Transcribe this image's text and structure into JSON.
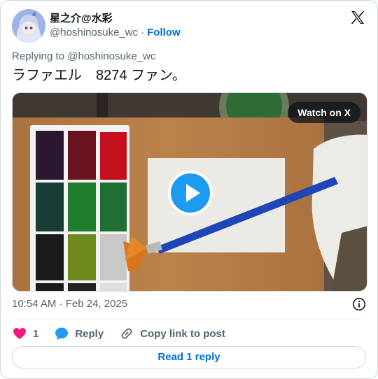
{
  "author": {
    "display_name": "星之介@水彩",
    "handle": "@hoshinosuke_wc",
    "separator": "·",
    "follow_label": "Follow"
  },
  "replying_to": "Replying to @hoshinosuke_wc",
  "tweet_text": "ラファエル　8274 ファン。",
  "media": {
    "watch_label": "Watch on X"
  },
  "timestamp": "10:54 AM · Feb 24, 2025",
  "actions": {
    "like_count": "1",
    "reply_label": "Reply",
    "copy_label": "Copy link to post"
  },
  "read_reply_label": "Read 1 reply",
  "colors": {
    "link_blue": "#006fd6",
    "play_blue": "#1d9bf0",
    "like_red": "#f91880",
    "muted": "#536471"
  }
}
